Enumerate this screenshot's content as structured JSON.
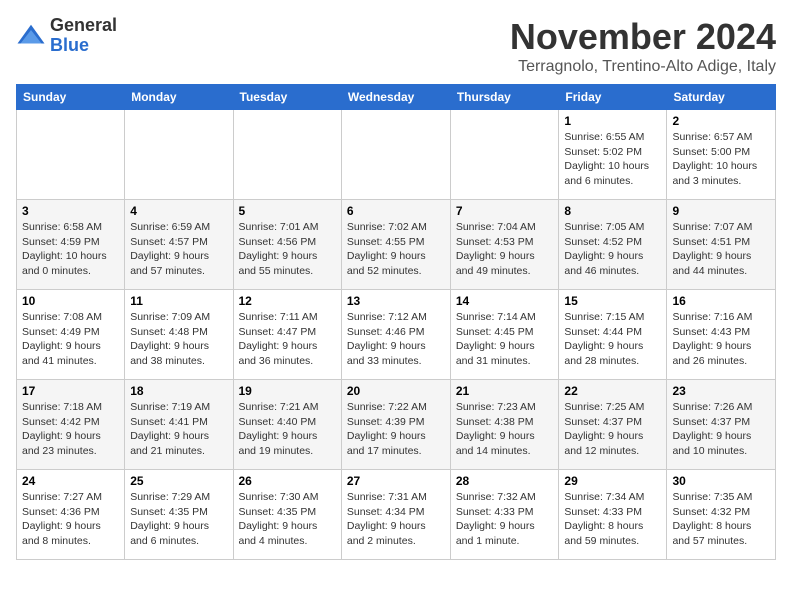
{
  "logo": {
    "general": "General",
    "blue": "Blue"
  },
  "title": "November 2024",
  "location": "Terragnolo, Trentino-Alto Adige, Italy",
  "headers": [
    "Sunday",
    "Monday",
    "Tuesday",
    "Wednesday",
    "Thursday",
    "Friday",
    "Saturday"
  ],
  "weeks": [
    [
      {
        "day": "",
        "info": ""
      },
      {
        "day": "",
        "info": ""
      },
      {
        "day": "",
        "info": ""
      },
      {
        "day": "",
        "info": ""
      },
      {
        "day": "",
        "info": ""
      },
      {
        "day": "1",
        "info": "Sunrise: 6:55 AM\nSunset: 5:02 PM\nDaylight: 10 hours and 6 minutes."
      },
      {
        "day": "2",
        "info": "Sunrise: 6:57 AM\nSunset: 5:00 PM\nDaylight: 10 hours and 3 minutes."
      }
    ],
    [
      {
        "day": "3",
        "info": "Sunrise: 6:58 AM\nSunset: 4:59 PM\nDaylight: 10 hours and 0 minutes."
      },
      {
        "day": "4",
        "info": "Sunrise: 6:59 AM\nSunset: 4:57 PM\nDaylight: 9 hours and 57 minutes."
      },
      {
        "day": "5",
        "info": "Sunrise: 7:01 AM\nSunset: 4:56 PM\nDaylight: 9 hours and 55 minutes."
      },
      {
        "day": "6",
        "info": "Sunrise: 7:02 AM\nSunset: 4:55 PM\nDaylight: 9 hours and 52 minutes."
      },
      {
        "day": "7",
        "info": "Sunrise: 7:04 AM\nSunset: 4:53 PM\nDaylight: 9 hours and 49 minutes."
      },
      {
        "day": "8",
        "info": "Sunrise: 7:05 AM\nSunset: 4:52 PM\nDaylight: 9 hours and 46 minutes."
      },
      {
        "day": "9",
        "info": "Sunrise: 7:07 AM\nSunset: 4:51 PM\nDaylight: 9 hours and 44 minutes."
      }
    ],
    [
      {
        "day": "10",
        "info": "Sunrise: 7:08 AM\nSunset: 4:49 PM\nDaylight: 9 hours and 41 minutes."
      },
      {
        "day": "11",
        "info": "Sunrise: 7:09 AM\nSunset: 4:48 PM\nDaylight: 9 hours and 38 minutes."
      },
      {
        "day": "12",
        "info": "Sunrise: 7:11 AM\nSunset: 4:47 PM\nDaylight: 9 hours and 36 minutes."
      },
      {
        "day": "13",
        "info": "Sunrise: 7:12 AM\nSunset: 4:46 PM\nDaylight: 9 hours and 33 minutes."
      },
      {
        "day": "14",
        "info": "Sunrise: 7:14 AM\nSunset: 4:45 PM\nDaylight: 9 hours and 31 minutes."
      },
      {
        "day": "15",
        "info": "Sunrise: 7:15 AM\nSunset: 4:44 PM\nDaylight: 9 hours and 28 minutes."
      },
      {
        "day": "16",
        "info": "Sunrise: 7:16 AM\nSunset: 4:43 PM\nDaylight: 9 hours and 26 minutes."
      }
    ],
    [
      {
        "day": "17",
        "info": "Sunrise: 7:18 AM\nSunset: 4:42 PM\nDaylight: 9 hours and 23 minutes."
      },
      {
        "day": "18",
        "info": "Sunrise: 7:19 AM\nSunset: 4:41 PM\nDaylight: 9 hours and 21 minutes."
      },
      {
        "day": "19",
        "info": "Sunrise: 7:21 AM\nSunset: 4:40 PM\nDaylight: 9 hours and 19 minutes."
      },
      {
        "day": "20",
        "info": "Sunrise: 7:22 AM\nSunset: 4:39 PM\nDaylight: 9 hours and 17 minutes."
      },
      {
        "day": "21",
        "info": "Sunrise: 7:23 AM\nSunset: 4:38 PM\nDaylight: 9 hours and 14 minutes."
      },
      {
        "day": "22",
        "info": "Sunrise: 7:25 AM\nSunset: 4:37 PM\nDaylight: 9 hours and 12 minutes."
      },
      {
        "day": "23",
        "info": "Sunrise: 7:26 AM\nSunset: 4:37 PM\nDaylight: 9 hours and 10 minutes."
      }
    ],
    [
      {
        "day": "24",
        "info": "Sunrise: 7:27 AM\nSunset: 4:36 PM\nDaylight: 9 hours and 8 minutes."
      },
      {
        "day": "25",
        "info": "Sunrise: 7:29 AM\nSunset: 4:35 PM\nDaylight: 9 hours and 6 minutes."
      },
      {
        "day": "26",
        "info": "Sunrise: 7:30 AM\nSunset: 4:35 PM\nDaylight: 9 hours and 4 minutes."
      },
      {
        "day": "27",
        "info": "Sunrise: 7:31 AM\nSunset: 4:34 PM\nDaylight: 9 hours and 2 minutes."
      },
      {
        "day": "28",
        "info": "Sunrise: 7:32 AM\nSunset: 4:33 PM\nDaylight: 9 hours and 1 minute."
      },
      {
        "day": "29",
        "info": "Sunrise: 7:34 AM\nSunset: 4:33 PM\nDaylight: 8 hours and 59 minutes."
      },
      {
        "day": "30",
        "info": "Sunrise: 7:35 AM\nSunset: 4:32 PM\nDaylight: 8 hours and 57 minutes."
      }
    ]
  ]
}
